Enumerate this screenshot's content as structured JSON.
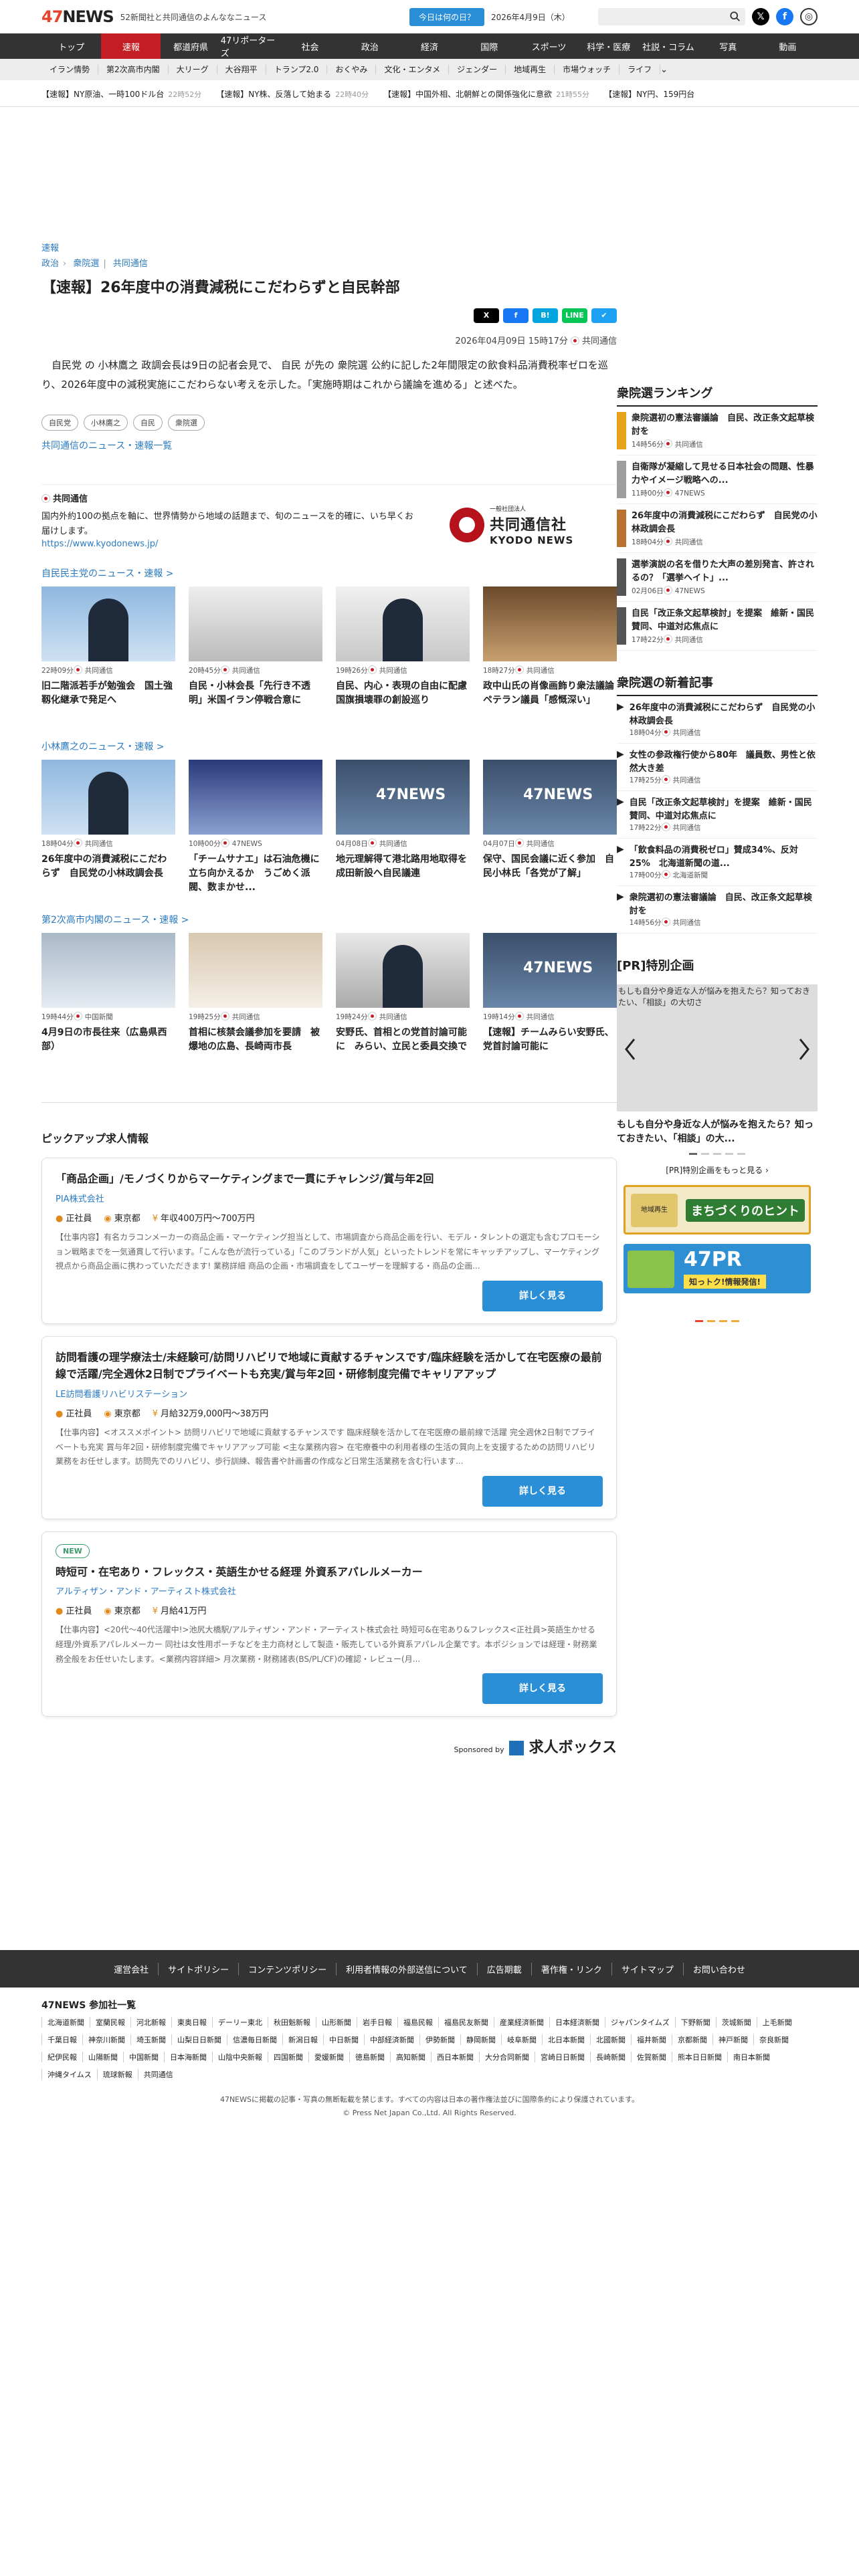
{
  "header": {
    "logo": "47NEWS",
    "tagline": "52新聞社と共同通信のよんななニュース",
    "today_button": "今日は何の日？",
    "date": "2026年4月9日（木）",
    "search_placeholder": ""
  },
  "gnav": [
    "トップ",
    "速報",
    "都道府県",
    "47リポーターズ",
    "社会",
    "政治",
    "経済",
    "国際",
    "スポーツ",
    "科学・医療",
    "社説・コラム",
    "写真",
    "動画"
  ],
  "gnav_active": 1,
  "snav": [
    "イラン情勢",
    "第2次高市内閣",
    "大リーグ",
    "大谷翔平",
    "トランプ2.0",
    "おくやみ",
    "文化・エンタメ",
    "ジェンダー",
    "地域再生",
    "市場ウォッチ",
    "ライフ"
  ],
  "ticker": [
    {
      "text": "【速報】NY原油、一時100ドル台",
      "time": "22時52分"
    },
    {
      "text": "【速報】NY株、反落して始まる",
      "time": "22時40分"
    },
    {
      "text": "【速報】中国外相、北朝鮮との関係強化に意欲",
      "time": "21時55分"
    },
    {
      "text": "【速報】NY円、159円台",
      "time": ""
    }
  ],
  "article": {
    "category": "速報",
    "breadcrumb": [
      "政治",
      "衆院選",
      "共同通信"
    ],
    "title": "【速報】26年度中の消費減税にこだわらずと自民幹部",
    "date": "2026年04月09日 15時17分",
    "source": "共同通信",
    "body": "自民党 の 小林鷹之 政調会長は9日の記者会見で、 自民 が先の 衆院選 公約に記した2年間限定の飲食料品消費税率ゼロを巡り、2026年度中の減税実施にこだわらない考えを示した。「実施時期はこれから議論を進める」と述べた。",
    "tags": [
      "自民党",
      "小林鷹之",
      "自民",
      "衆院選"
    ],
    "more_link": "共同通信のニュース・速報一覧"
  },
  "share": [
    "X",
    "f",
    "B!",
    "LINE",
    "✔"
  ],
  "provider": {
    "name": "共同通信",
    "desc": "国内外約100の拠点を軸に、世界情勢から地域の話題まで、旬のニュースを的確に、いち早くお届けします。",
    "url": "https://www.kyodonews.jp/",
    "logo_small": "一般社団法人",
    "logo_name": "共同通信社",
    "logo_en": "KYODO NEWS"
  },
  "sections": [
    {
      "title": "自民民主党のニュース・速報 >",
      "cards": [
        {
          "time": "22時09分",
          "src": "共同通信",
          "title": "旧二階派若手が勉強会　国土強靱化継承で発足へ",
          "thumb": "person-blue"
        },
        {
          "time": "20時45分",
          "src": "共同通信",
          "title": "自民・小林会長「先行き不透明」米国イラン停戦合意に",
          "thumb": "room"
        },
        {
          "time": "19時26分",
          "src": "共同通信",
          "title": "自民、内心・表現の自由に配慮　国旗損壊罪の創設巡り",
          "thumb": "podium"
        },
        {
          "time": "18時27分",
          "src": "共同通信",
          "title": "政中山氏の肖像画飾り衆法議論　ペテラン議員「感慨深い」",
          "thumb": "portrait"
        }
      ]
    },
    {
      "title": "小林鷹之のニュース・速報 >",
      "cards": [
        {
          "time": "18時04分",
          "src": "共同通信",
          "title": "26年度中の消費減税にこだわらず　自民党の小林政調会長",
          "thumb": "person-blue"
        },
        {
          "time": "10時00分",
          "src": "47NEWS",
          "title": "「チームサナエ」は石油危機に立ち向かえるか　うごめく派閥、数まかせ...",
          "thumb": "crowd"
        },
        {
          "time": "04月08日",
          "src": "共同通信",
          "title": "地元理解得て港北路用地取得を　成田新設へ自民議連",
          "thumb": "47news"
        },
        {
          "time": "04月07日",
          "src": "共同通信",
          "title": "保守、国民会議に近く参加　自民小林氏「各党が了解」",
          "thumb": "47news"
        }
      ]
    },
    {
      "title": "第2次高市内閣のニュース・速報 >",
      "cards": [
        {
          "time": "19時44分",
          "src": "中国新聞",
          "title": "4月9日の市長往来（広島県西部）",
          "thumb": "sign"
        },
        {
          "time": "19時25分",
          "src": "共同通信",
          "title": "首相に核禁会議参加を要請　被爆地の広島、長崎両市長",
          "thumb": "meeting"
        },
        {
          "time": "19時24分",
          "src": "共同通信",
          "title": "安野氏、首相との党首討論可能に　みらい、立民と委員交換で",
          "thumb": "suit"
        },
        {
          "time": "19時14分",
          "src": "共同通信",
          "title": "【速報】チームみらい安野氏、党首討論可能に",
          "thumb": "47news"
        }
      ]
    }
  ],
  "jobs": {
    "title": "ピックアップ求人情報",
    "items": [
      {
        "new": "",
        "title": "「商品企画」/モノづくりからマーケティングまで一貫にチャレンジ/賞与年2回",
        "company": "PIA株式会社",
        "type": "正社員",
        "place": "東京都",
        "salary": "年収400万円〜700万円",
        "desc": "【仕事内容】有名カラコンメーカーの商品企画・マーケティング担当として、市場調査から商品企画を行い、モデル・タレントの選定も含むプロモーション戦略までを一気通貫して行います。「こんな色が流行っている」「このブランドが人気」といったトレンドを常にキャッチアップし、マーケティング視点から商品企画に携わっていただきます! 業務詳細 商品の企画・市場調査をしてユーザーを理解する・商品の企画...",
        "button": "詳しく見る"
      },
      {
        "new": "",
        "title": "訪問看護の理学療法士/未経験可/訪問リハビリで地域に貢献するチャンスです/臨床経験を活かして在宅医療の最前線で活躍/完全週休2日制でプライベートも充実/賞与年2回・研修制度完備でキャリアアップ",
        "company": "LE訪問看護リハビリステーション",
        "type": "正社員",
        "place": "東京都",
        "salary": "月給32万9,000円〜38万円",
        "desc": "【仕事内容】<オススメポイント> 訪問リハビリで地域に貢献するチャンスです 臨床経験を活かして在宅医療の最前線で活躍 完全週休2日制でプライベートも充実 賞与年2回・研修制度完備でキャリアアップ可能 <主な業務内容> 在宅療養中の利用者様の生活の質向上を支援するための訪問リハビリ業務をお任せします。訪問先でのリハビリ、歩行訓練、報告書や計画書の作成など日常生活業務を含む行います...",
        "button": "詳しく見る"
      },
      {
        "new": "NEW",
        "title": "時短可・在宅あり・フレックス・英語生かせる経理 外資系アパレルメーカー",
        "company": "アルティザン・アンド・アーティスト株式会社",
        "type": "正社員",
        "place": "東京都",
        "salary": "月給41万円",
        "desc": "【仕事内容】<20代〜40代活躍中!>池尻大橋駅/アルティザン・アンド・アーティスト株式会社 時短可&在宅あり&フレックス<正社員>英語生かせる経理/外資系アパレルメーカー 同社は女性用ポーチなどを主力商材として製造・販売している外資系アパレル企業です。本ポジションでは経理・財務業務全般をお任せいたします。<業務内容詳細> 月次業務・財務諸表(BS/PL/CF)の確認・レビュー(月...",
        "button": "詳しく見る"
      }
    ],
    "sponsor_label": "Sponsored by",
    "sponsor_name": "求人ボックス"
  },
  "ranking": {
    "title": "衆院選ランキング",
    "items": [
      {
        "title": "衆院選初の憲法審議論　自民、改正条文起草検討を",
        "time": "14時56分",
        "src": "共同通信",
        "color": "#e8a31c"
      },
      {
        "title": "自衛隊が凝縮して見せる日本社会の問題、性暴力やイメージ戦略への...",
        "time": "11時00分",
        "src": "47NEWS",
        "color": "#9e9e9e"
      },
      {
        "title": "26年度中の消費減税にこだわらず　自民党の小林政調会長",
        "time": "18時04分",
        "src": "共同通信",
        "color": "#b87333"
      },
      {
        "title": "選挙演説の名を借りた大声の差別発言、許されるの？「選挙ヘイト」...",
        "time": "02月06日",
        "src": "47NEWS",
        "color": "#555"
      },
      {
        "title": "自民「改正条文起草検討」を提案　維新・国民賛同、中道対応焦点に",
        "time": "17時22分",
        "src": "共同通信",
        "color": "#555"
      }
    ]
  },
  "newest": {
    "title": "衆院選の新着記事",
    "items": [
      {
        "title": "26年度中の消費減税にこだわらず　自民党の小林政調会長",
        "time": "18時04分",
        "src": "共同通信"
      },
      {
        "title": "女性の参政権行使から80年　議員数、男性と依然大き差",
        "time": "17時25分",
        "src": "共同通信"
      },
      {
        "title": "自民「改正条文起草検討」を提案　維新・国民賛同、中道対応焦点に",
        "time": "17時22分",
        "src": "共同通信"
      },
      {
        "title": "「飲食料品の消費税ゼロ」賛成34%、反対25%　北海道新聞の道...",
        "time": "17時00分",
        "src": "北海道新聞"
      },
      {
        "title": "衆院選初の憲法審議論　自民、改正条文起草検討を",
        "time": "14時56分",
        "src": "共同通信"
      }
    ]
  },
  "pr": {
    "title": "[PR]特別企画",
    "image_alt": "もしも自分や身近な人が悩みを抱えたら？知っておきたい、「相談」の大切さ",
    "caption": "もしも自分や身近な人が悩みを抱えたら？知っておきたい、「相談」の大...",
    "more": "[PR]特別企画をもっと見る ›"
  },
  "banners": [
    {
      "text": "まちづくりのヒント",
      "sub": "地域再生"
    },
    {
      "text": "47PR",
      "sub": "知っトク!情報発信!"
    }
  ],
  "footer": {
    "links": [
      "運営会社",
      "サイトポリシー",
      "コンテンツポリシー",
      "利用者情報の外部送信について",
      "広告期載",
      "著作権・リンク",
      "サイトマップ",
      "お問い合わせ"
    ],
    "partners_title": "47NEWS 参加社一覧",
    "partners": [
      "北海道新聞",
      "室蘭民報",
      "河北新報",
      "東奥日報",
      "デーリー東北",
      "秋田魁新報",
      "山形新聞",
      "岩手日報",
      "福島民報",
      "福島民友新聞",
      "産業経済新聞",
      "日本経済新聞",
      "ジャパンタイムズ",
      "下野新聞",
      "茨城新聞",
      "上毛新聞",
      "千葉日報",
      "神奈川新聞",
      "埼玉新聞",
      "山梨日日新聞",
      "信濃毎日新聞",
      "新潟日報",
      "中日新聞",
      "中部経済新聞",
      "伊勢新聞",
      "静岡新聞",
      "岐阜新聞",
      "北日本新聞",
      "北國新聞",
      "福井新聞",
      "京都新聞",
      "神戸新聞",
      "奈良新聞",
      "紀伊民報",
      "山陽新聞",
      "中国新聞",
      "日本海新聞",
      "山陰中央新報",
      "四国新聞",
      "愛媛新聞",
      "徳島新聞",
      "高知新聞",
      "西日本新聞",
      "大分合同新聞",
      "宮崎日日新聞",
      "長崎新聞",
      "佐賀新聞",
      "熊本日日新聞",
      "南日本新聞",
      "沖縄タイムス",
      "琉球新報",
      "共同通信"
    ],
    "notice": "47NEWSに掲載の記事・写真の無断転載を禁じます。すべての内容は日本の著作権法並びに国際条約により保護されています。",
    "copyright": "© Press Net Japan Co.,Ltd. All Rights Reserved."
  }
}
